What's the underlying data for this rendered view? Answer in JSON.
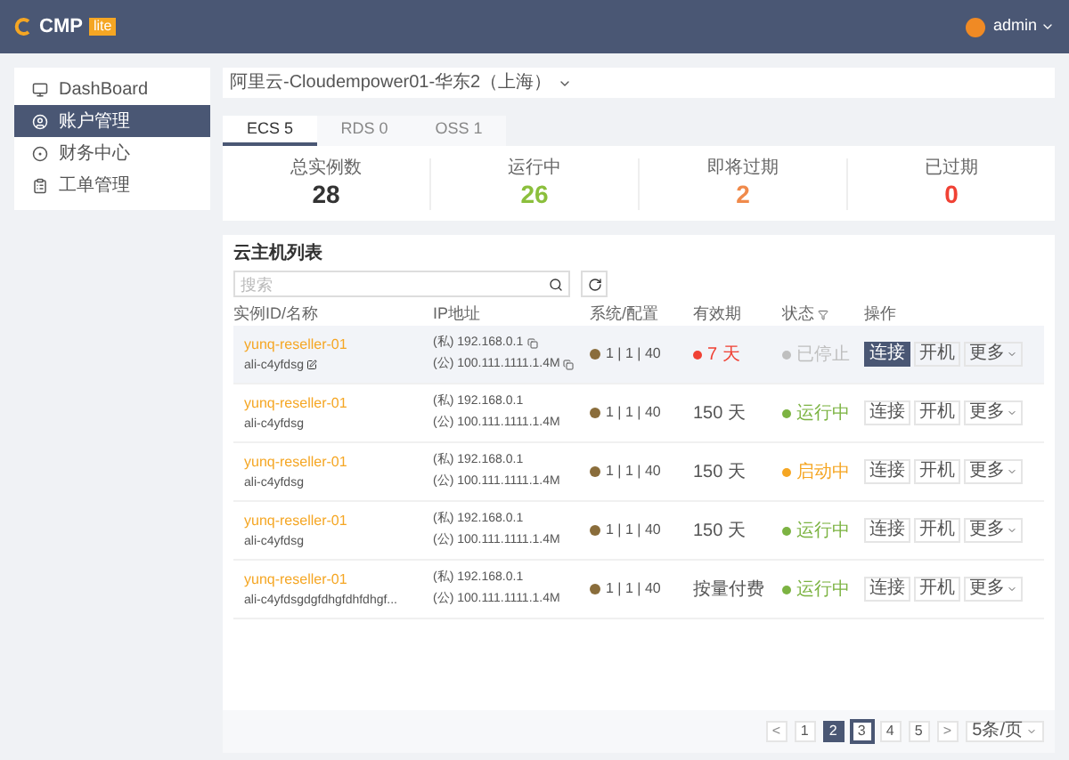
{
  "header": {
    "logo": "CMP",
    "logo_badge": "lite",
    "user": "admin"
  },
  "sidebar": {
    "items": [
      {
        "label": "DashBoard",
        "selected": false
      },
      {
        "label": "账户管理",
        "selected": true
      },
      {
        "label": "财务中心",
        "selected": false
      },
      {
        "label": "工单管理",
        "selected": false
      }
    ]
  },
  "region": "阿里云-Cloudempower01-华东2（上海）",
  "tabs": [
    {
      "label": "ECS 5",
      "selected": true
    },
    {
      "label": "RDS 0",
      "selected": false
    },
    {
      "label": "OSS 1",
      "selected": false
    }
  ],
  "stats": [
    {
      "label": "总实例数",
      "value": "28",
      "color": "#333333"
    },
    {
      "label": "运行中",
      "value": "26",
      "color": "#8bbf3c"
    },
    {
      "label": "即将过期",
      "value": "2",
      "color": "#f08a4b"
    },
    {
      "label": "已过期",
      "value": "0",
      "color": "#f04134"
    }
  ],
  "list": {
    "title": "云主机列表",
    "search": {
      "placeholder": "搜索"
    },
    "columns": [
      "实例ID/名称",
      "IP地址",
      "系统/配置",
      "有效期",
      "状态",
      "操作"
    ],
    "rows": [
      {
        "id": "yunq-reseller-01",
        "name": "ali-c4yfdsg",
        "private_ip": "(私) 192.168.0.1",
        "public_ip": "(公) 100.111.1111.1.4M",
        "config": "1 | 1 | 40",
        "expiry": "7 天",
        "expiring": true,
        "status": "已停止",
        "color": "#bfbfbf",
        "selected": true,
        "actions": [
          "连接",
          "开机",
          "更多"
        ]
      },
      {
        "id": "yunq-reseller-01",
        "name": "ali-c4yfdsg",
        "private_ip": "(私) 192.168.0.1",
        "public_ip": "(公) 100.111.1111.1.4M",
        "config": "1 | 1 | 40",
        "expiry": "150 天",
        "expiring": false,
        "status": "运行中",
        "color": "#7cb342",
        "selected": false,
        "actions": [
          "连接",
          "开机",
          "更多"
        ]
      },
      {
        "id": "yunq-reseller-01",
        "name": "ali-c4yfdsg",
        "private_ip": "(私) 192.168.0.1",
        "public_ip": "(公) 100.111.1111.1.4M",
        "config": "1 | 1 | 40",
        "expiry": "150 天",
        "expiring": false,
        "status": "启动中",
        "color": "#f5a623",
        "selected": false,
        "actions": [
          "连接",
          "开机",
          "更多"
        ]
      },
      {
        "id": "yunq-reseller-01",
        "name": "ali-c4yfdsg",
        "private_ip": "(私) 192.168.0.1",
        "public_ip": "(公) 100.111.1111.1.4M",
        "config": "1 | 1 | 40",
        "expiry": "150 天",
        "expiring": false,
        "status": "运行中",
        "color": "#7cb342",
        "selected": false,
        "actions": [
          "连接",
          "开机",
          "更多"
        ]
      },
      {
        "id": "yunq-reseller-01",
        "name": "ali-c4yfdsgdgfdhgfdhfdhgf...",
        "private_ip": "(私) 192.168.0.1",
        "public_ip": "(公) 100.111.1111.1.4M",
        "config": "1 | 1 | 40",
        "expiry": "按量付费",
        "expiring": false,
        "status": "运行中",
        "color": "#7cb342",
        "selected": false,
        "actions": [
          "连接",
          "开机",
          "更多"
        ]
      }
    ]
  },
  "pagination": {
    "prev": "<",
    "next": ">",
    "pages": [
      {
        "label": "1",
        "selected": false,
        "outlined": false
      },
      {
        "label": "2",
        "selected": true,
        "outlined": false
      },
      {
        "label": "3",
        "selected": false,
        "outlined": true
      },
      {
        "label": "4",
        "selected": false,
        "outlined": false
      },
      {
        "label": "5",
        "selected": false,
        "outlined": false
      }
    ],
    "page_size": "5条/页"
  }
}
